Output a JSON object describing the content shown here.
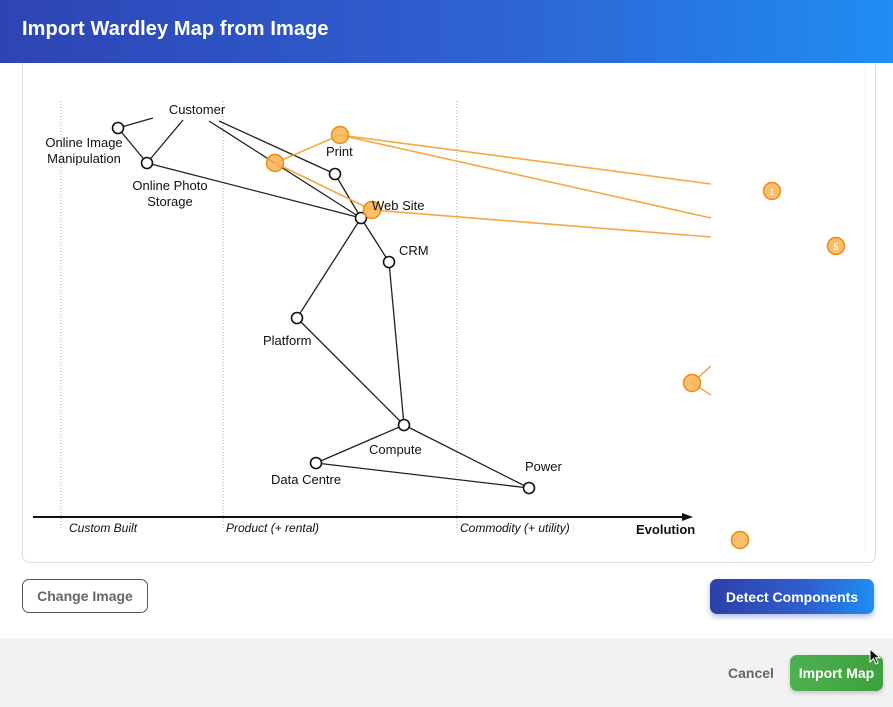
{
  "dialog": {
    "title": "Import Wardley Map from Image"
  },
  "map": {
    "components": [
      {
        "label": "Customer"
      },
      {
        "label": "Online Image"
      },
      {
        "label": "Manipulation"
      },
      {
        "label": "Online Photo"
      },
      {
        "label": "Storage"
      },
      {
        "label": "Print"
      },
      {
        "label": "Web Site"
      },
      {
        "label": "CRM"
      },
      {
        "label": "Platform"
      },
      {
        "label": "Compute"
      },
      {
        "label": "Data Centre"
      },
      {
        "label": "Power"
      }
    ],
    "axis": {
      "stage1": "Custom Built",
      "stage2": "Product (+ rental)",
      "stage3": "Commodity (+ utility)",
      "label": "Evolution"
    },
    "markers": {
      "m1": "1",
      "m5": "5"
    },
    "highlight_color": "#f5a030"
  },
  "actions": {
    "change_image": "Change Image",
    "detect": "Detect Components",
    "cancel": "Cancel",
    "import": "Import Map"
  }
}
